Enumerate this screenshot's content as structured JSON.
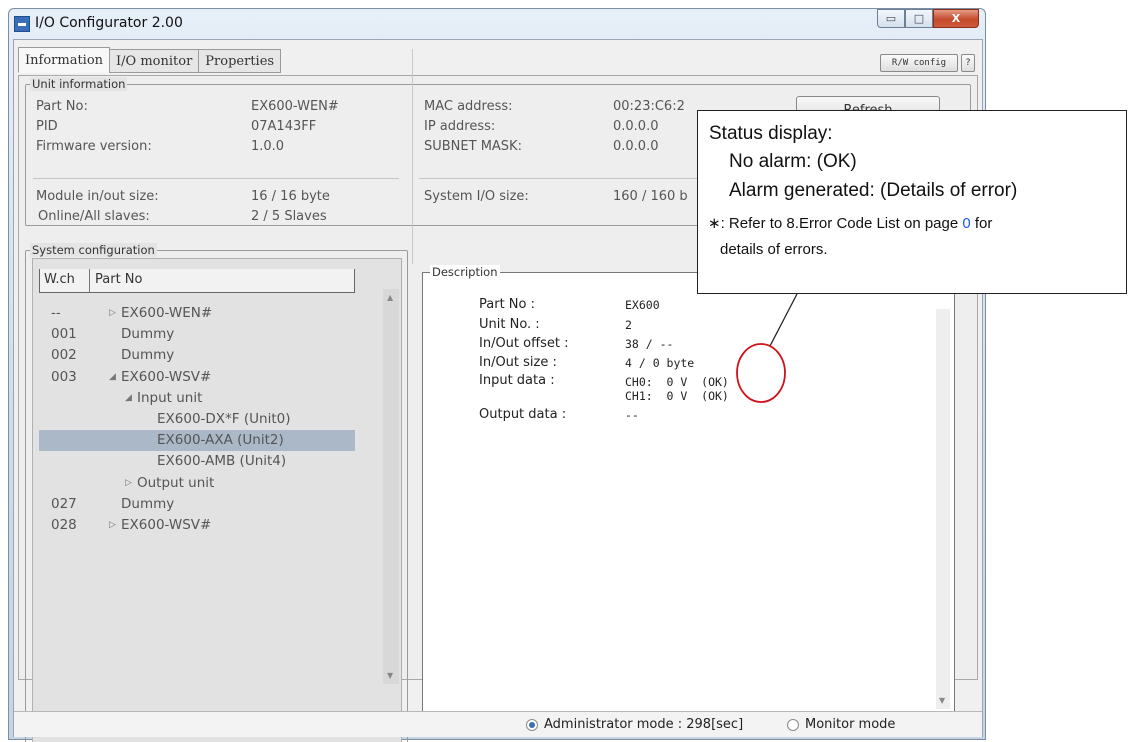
{
  "window": {
    "title": "I/O Configurator 2.00",
    "min_glyph": "▭",
    "max_glyph": "□",
    "close_glyph": "X"
  },
  "tabs": [
    {
      "label": "Information",
      "active": true
    },
    {
      "label": "I/O monitor",
      "active": false
    },
    {
      "label": "Properties",
      "active": false
    }
  ],
  "toolbar": {
    "rw_config_label": "R/W config",
    "help_label": "?",
    "refresh_label": "Refresh"
  },
  "unit_info": {
    "group_label": "Unit information",
    "left": [
      {
        "key": "Part No:",
        "value": "EX600-WEN#"
      },
      {
        "key": "PID",
        "value": "07A143FF"
      },
      {
        "key": "Firmware version:",
        "value": "1.0.0"
      },
      {
        "key": "Module in/out size:",
        "value": "16 / 16 byte"
      },
      {
        "key": "Online/All slaves:",
        "value": "2 / 5 Slaves"
      }
    ],
    "right": [
      {
        "key": "MAC address:",
        "value": "00:23:C6:2"
      },
      {
        "key": "IP address:",
        "value": "0.0.0.0"
      },
      {
        "key": "SUBNET MASK:",
        "value": "0.0.0.0"
      },
      {
        "key": "System I/O size:",
        "value": "160 / 160 b"
      }
    ]
  },
  "system_config": {
    "group_label": "System configuration",
    "headers": {
      "wch": "W.ch",
      "part": "Part No"
    },
    "rows": [
      {
        "wch": "--",
        "arrow": "▷",
        "label": "EX600-WEN#",
        "indent": 0,
        "selected": false
      },
      {
        "wch": "001",
        "arrow": "",
        "label": "Dummy",
        "indent": 0,
        "selected": false
      },
      {
        "wch": "002",
        "arrow": "",
        "label": "Dummy",
        "indent": 0,
        "selected": false
      },
      {
        "wch": "003",
        "arrow": "◢",
        "label": "EX600-WSV#",
        "indent": 0,
        "selected": false
      },
      {
        "wch": "",
        "arrow": "◢",
        "label": "Input unit",
        "indent": 1,
        "selected": false
      },
      {
        "wch": "",
        "arrow": "",
        "label": "EX600-DX*F (Unit0)",
        "indent": 2,
        "selected": false
      },
      {
        "wch": "",
        "arrow": "",
        "label": "EX600-AXA (Unit2)",
        "indent": 2,
        "selected": true
      },
      {
        "wch": "",
        "arrow": "",
        "label": "EX600-AMB (Unit4)",
        "indent": 2,
        "selected": false
      },
      {
        "wch": "",
        "arrow": "▷",
        "label": "Output unit",
        "indent": 1,
        "selected": false
      },
      {
        "wch": "027",
        "arrow": "",
        "label": "Dummy",
        "indent": 0,
        "selected": false
      },
      {
        "wch": "028",
        "arrow": "▷",
        "label": "EX600-WSV#",
        "indent": 0,
        "selected": false
      }
    ]
  },
  "description": {
    "group_label": "Description",
    "rows": [
      {
        "key": "Part No :",
        "value": "EX600"
      },
      {
        "key": "Unit No. :",
        "value": "2"
      },
      {
        "key": "In/Out offset :",
        "value": "38 / --"
      },
      {
        "key": "In/Out size :",
        "value": "4 / 0 byte"
      },
      {
        "key": "Input data :",
        "value": "CH0:  0 V  (OK)"
      },
      {
        "key": "",
        "value": "CH1:  0 V  (OK)"
      },
      {
        "key": "Output data :",
        "value": "--"
      }
    ]
  },
  "status_bar": {
    "admin_mode_label": "Administrator mode : 298[sec]",
    "monitor_mode_label": "Monitor mode",
    "selected": "admin"
  },
  "callout": {
    "line1": "Status display:",
    "line2": "No alarm: (OK)",
    "line3": "Alarm generated: (Details of error)",
    "note_prefix": "∗: Refer to 8.Error Code List on page ",
    "note_page": "0",
    "note_suffix": " for",
    "note_line2": "details of errors."
  },
  "colors": {
    "selection": "#aab8c8",
    "annotation_circle": "#d0121b",
    "link_blue": "#1a55ff"
  }
}
